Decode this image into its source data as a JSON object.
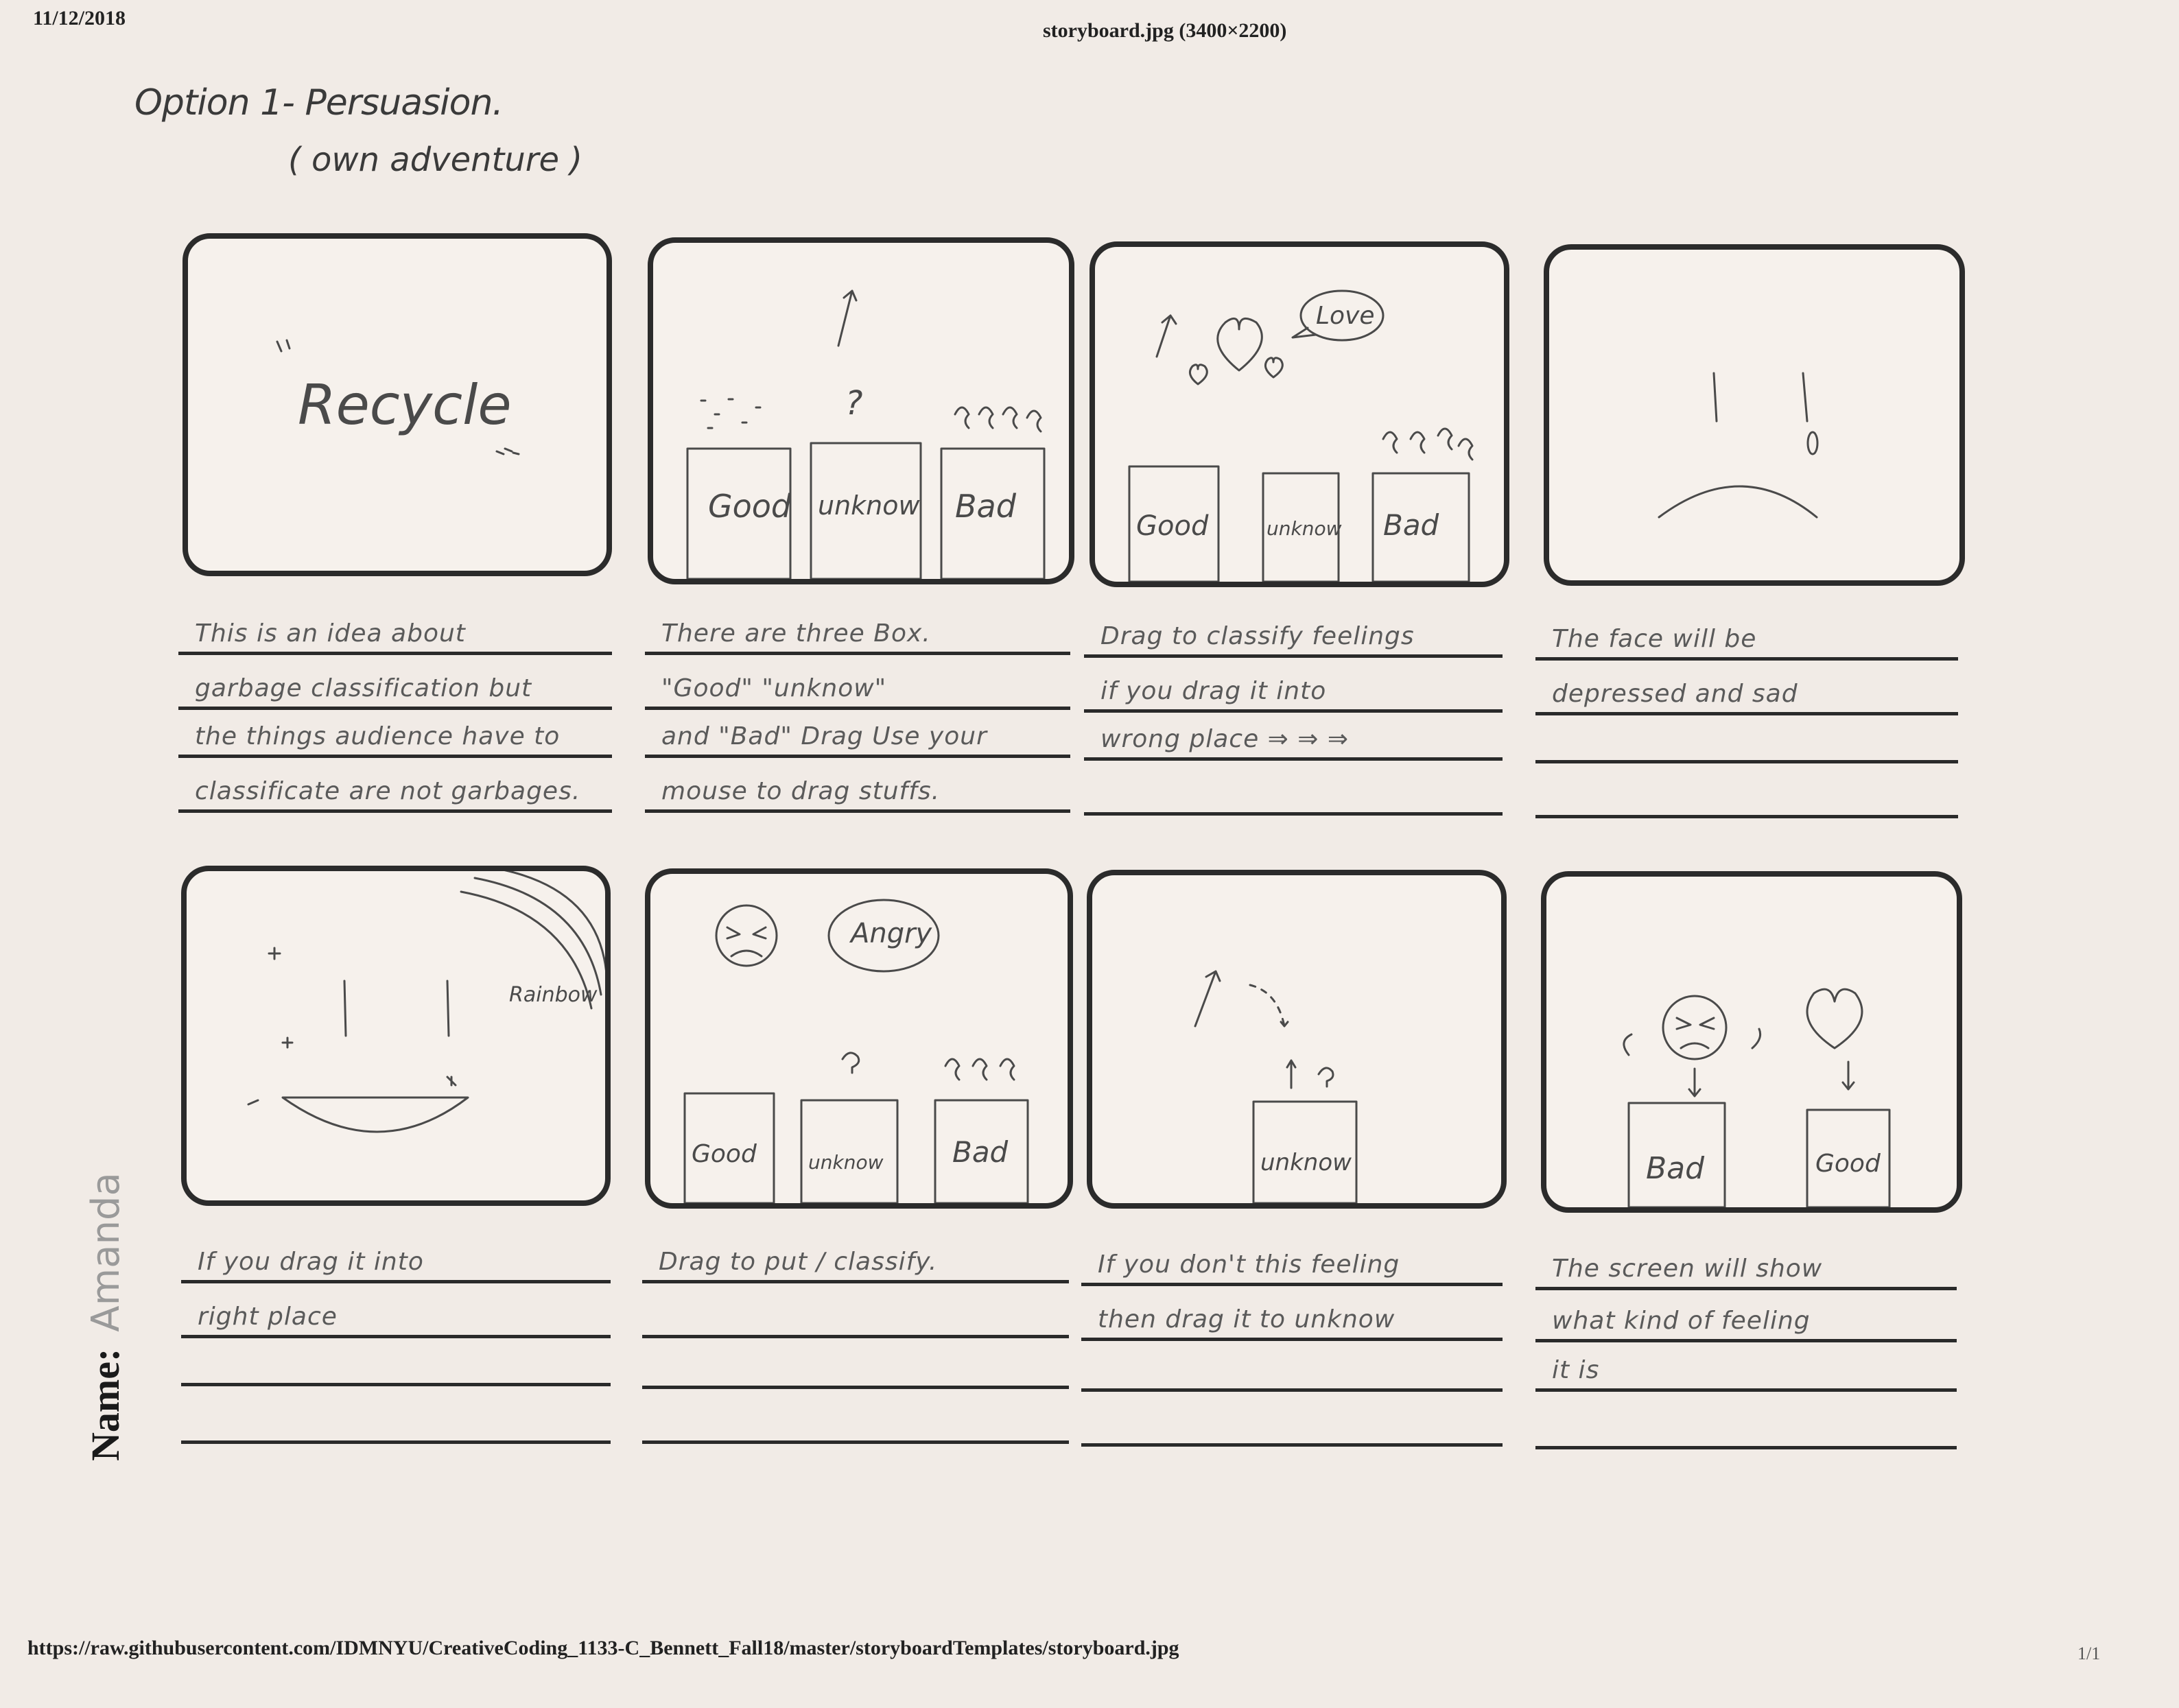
{
  "header": {
    "date": "11/12/2018",
    "title": "storyboard.jpg (3400×2200)"
  },
  "option": {
    "title": "Option 1- Persuasion.",
    "subtitle": "( own adventure )"
  },
  "name": {
    "label": "Name:",
    "value": "Amanda"
  },
  "panels": [
    {
      "sketch": {
        "text": "Recycle"
      },
      "caption": [
        "This is an idea about",
        "garbage classification but",
        "the things audience have to",
        "classificate are not garbages."
      ]
    },
    {
      "sketch": {
        "boxes": [
          "Good",
          "unknow",
          "Bad"
        ],
        "mark": "?"
      },
      "caption": [
        "There are three Box.",
        "\"Good\" \"unknow\"",
        "and \"Bad\" Drag Use your",
        "mouse to drag stuffs."
      ]
    },
    {
      "sketch": {
        "boxes": [
          "Good",
          "unknow",
          "Bad"
        ],
        "bubble": "Love"
      },
      "caption": [
        "Drag to classify feelings",
        "if you drag it into",
        "wrong place ⇒ ⇒ ⇒",
        ""
      ]
    },
    {
      "sketch": {},
      "caption": [
        "The face will be",
        "depressed and sad",
        "",
        ""
      ]
    },
    {
      "sketch": {
        "label": "Rainbow"
      },
      "caption": [
        "If you drag it into",
        "right place",
        "",
        ""
      ]
    },
    {
      "sketch": {
        "boxes": [
          "Good",
          "unknow",
          "Bad"
        ],
        "bubble": "Angry"
      },
      "caption": [
        "Drag to put / classify.",
        "",
        "",
        ""
      ]
    },
    {
      "sketch": {
        "box": "unknow"
      },
      "caption": [
        "If you don't this feeling",
        "then drag it to unknow",
        "",
        ""
      ]
    },
    {
      "sketch": {
        "boxes": [
          "Bad",
          "Good"
        ]
      },
      "caption": [
        "The screen will show",
        "what kind of feeling",
        "it is",
        ""
      ]
    }
  ],
  "footer": {
    "url": "https://raw.githubusercontent.com/IDMNYU/CreativeCoding_1133-C_Bennett_Fall18/master/storyboardTemplates/storyboard.jpg",
    "page": "1/1"
  }
}
